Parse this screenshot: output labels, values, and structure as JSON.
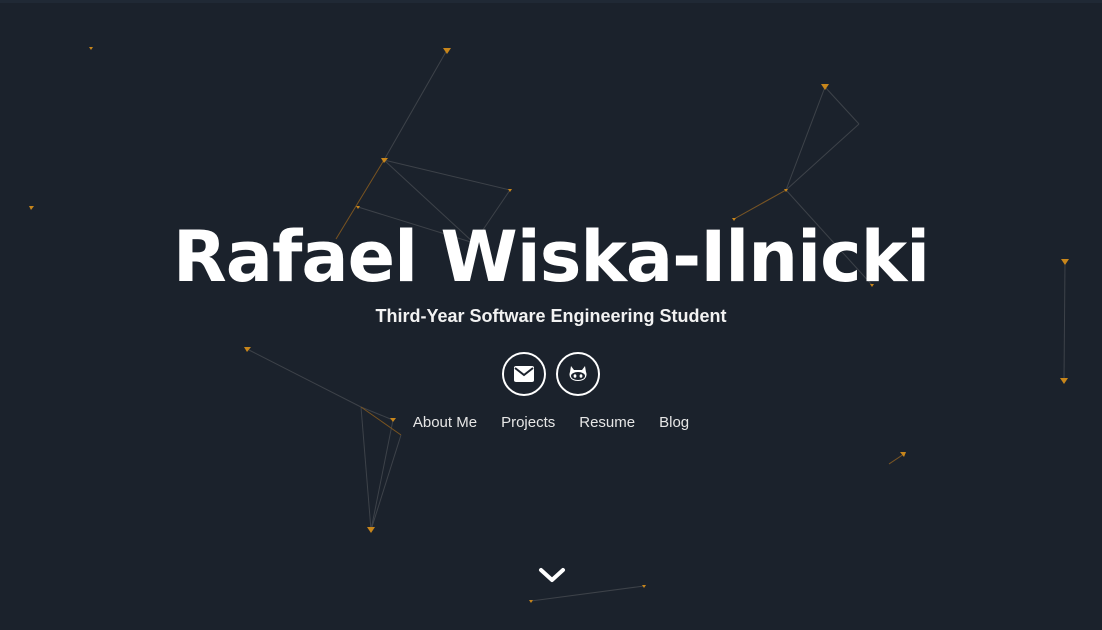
{
  "hero": {
    "title": "Rafael Wiska-Ilnicki",
    "subtitle": "Third-Year Software Engineering Student"
  },
  "socials": [
    {
      "icon": "envelope-icon",
      "label": "email"
    },
    {
      "icon": "github-icon",
      "label": "github"
    }
  ],
  "nav": {
    "items": [
      "About Me",
      "Projects",
      "Resume",
      "Blog"
    ]
  },
  "scroll": {
    "icon": "chevron-down-icon"
  },
  "colors": {
    "background": "#1b222c",
    "particle": "#c8861b",
    "line": "#3a3f45",
    "text": "#ffffff"
  }
}
